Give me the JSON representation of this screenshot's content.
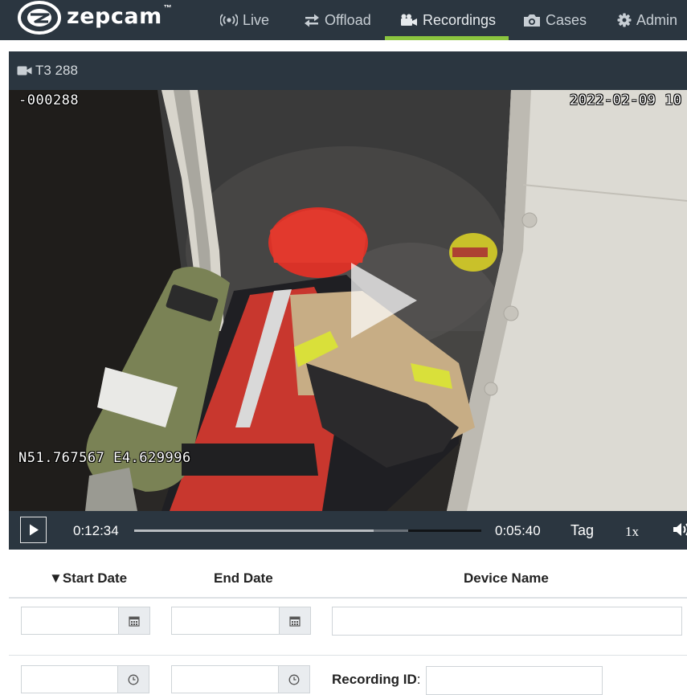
{
  "brand": {
    "name": "zepcam",
    "trademark": "™"
  },
  "nav": {
    "items": [
      {
        "label": "Live",
        "icon": "broadcast-icon"
      },
      {
        "label": "Offload",
        "icon": "transfer-arrows-icon"
      },
      {
        "label": "Recordings",
        "icon": "video-camera-icon",
        "active": true
      },
      {
        "label": "Cases",
        "icon": "camera-icon"
      },
      {
        "label": "Admin",
        "icon": "gear-icon"
      }
    ]
  },
  "player": {
    "title": "T3 288",
    "osd": {
      "id": "-000288",
      "timestamp": "2022-02-09 10",
      "gps": "N51.767567 E4.629996"
    },
    "controls": {
      "current_time": "0:12:34",
      "remaining_time": "0:05:40",
      "tag_label": "Tag",
      "speed_label": "1x",
      "progress_fraction": 0.69,
      "buffered_fraction": 0.79
    }
  },
  "filters": {
    "columns": {
      "start_date": "▼Start Date",
      "end_date": "End Date",
      "device_name": "Device Name"
    },
    "start_date_value": "",
    "end_date_value": "",
    "device_name_value": "",
    "start_time_value": "",
    "end_time_value": "",
    "recording_id_label": "Recording ID",
    "recording_id_colon": ":",
    "recording_id_value": ""
  },
  "colors": {
    "nav_bg": "#2b3640",
    "active_underline": "#8bc53f",
    "nav_text": "#c7ced4"
  }
}
